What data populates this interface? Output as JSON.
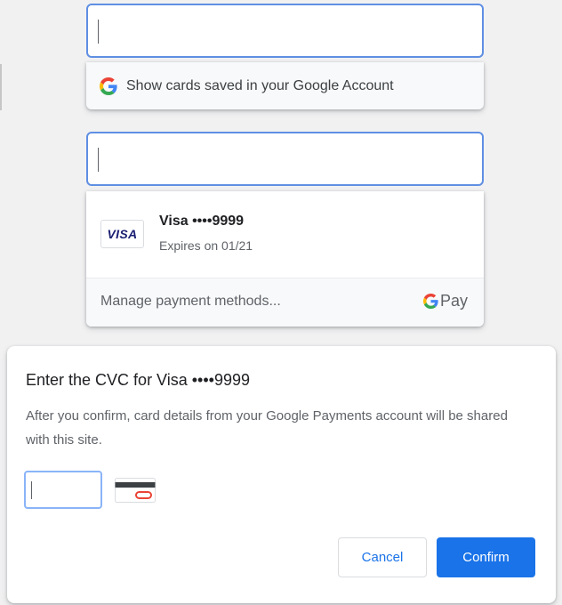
{
  "autofill_top": {
    "input_value": "",
    "suggestion": {
      "label": "Show cards saved in your Google Account",
      "icon": "google-g-icon"
    }
  },
  "autofill_card": {
    "input_value": "",
    "card": {
      "brand_logo_text": "VISA",
      "name": "Visa ••••9999",
      "expiry": "Expires on 01/21"
    },
    "manage_label": "Manage payment methods...",
    "gpay_label": "Pay"
  },
  "cvc_dialog": {
    "title": "Enter the CVC for Visa ••••9999",
    "body": "After you confirm, card details from your Google Payments account will be shared with this site.",
    "cvc_value": "",
    "cancel_label": "Cancel",
    "confirm_label": "Confirm"
  },
  "colors": {
    "accent": "#1a73e8",
    "focus_border": "#5f8fe3",
    "visa_blue": "#1a1f71",
    "cvc_red": "#ea4335"
  }
}
